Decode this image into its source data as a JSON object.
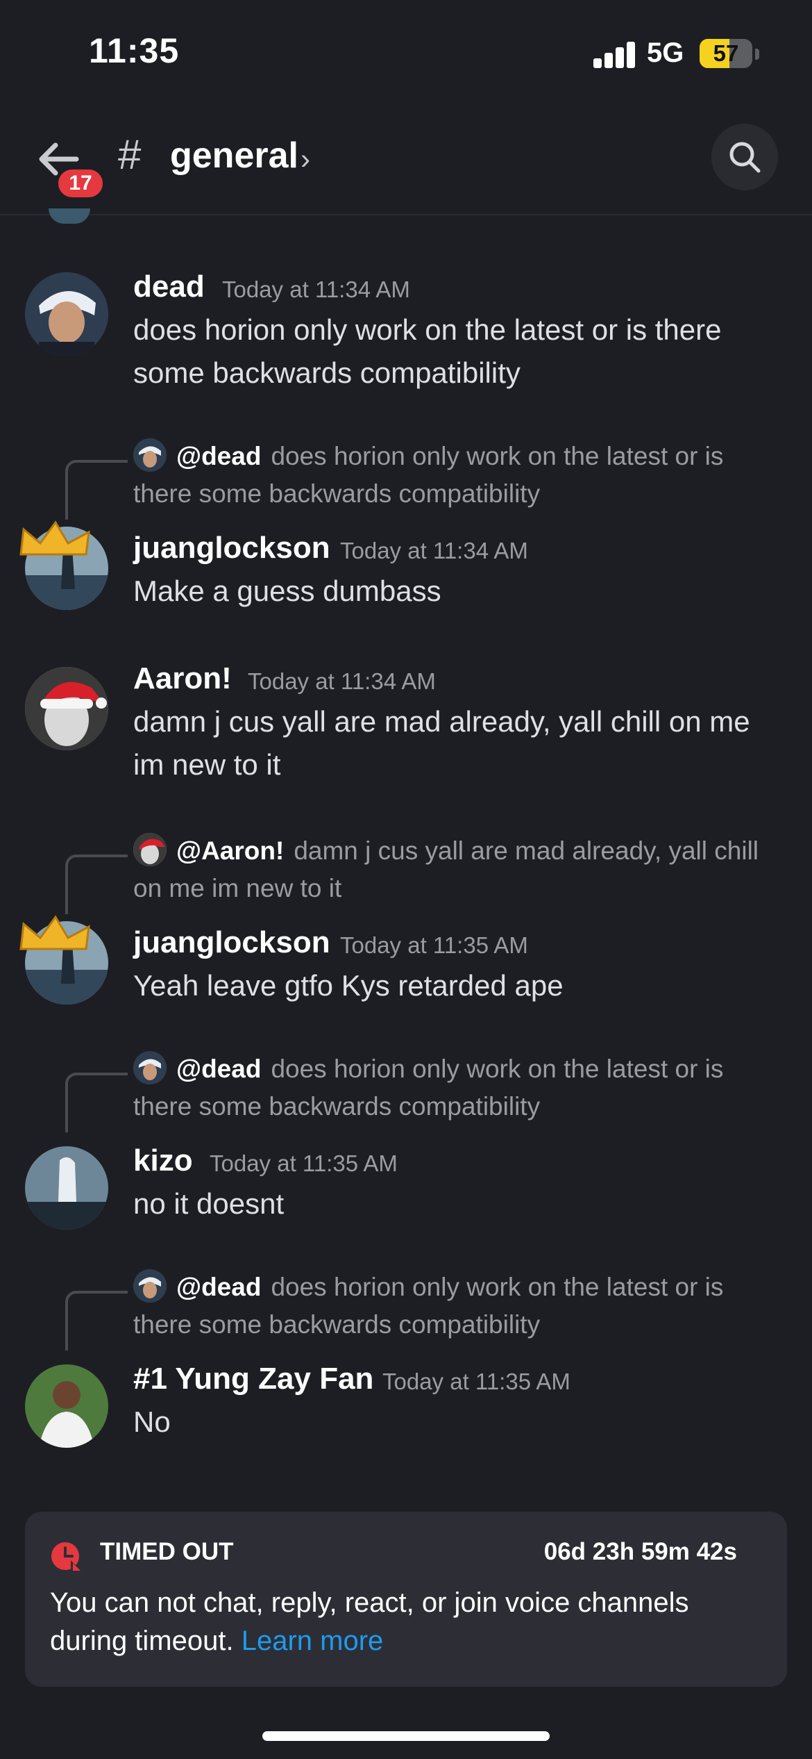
{
  "status": {
    "time": "11:35",
    "network": "5G",
    "battery": "57",
    "battery_level": 0.57
  },
  "header": {
    "hash": "#",
    "channel": "general",
    "chevron": "›",
    "badge": "17"
  },
  "messages": [
    {
      "username": "dead",
      "timestamp": "Today at 11:34 AM",
      "text": "does horion only work on the latest or is there some backwards compatibility"
    },
    {
      "reply_to": "@dead",
      "reply_text": "does horion only work on the latest or is there some backwards compatibility",
      "username": "juanglockson",
      "timestamp": "Today at 11:34 AM",
      "text": "Make a guess dumbass"
    },
    {
      "username": "Aaron!",
      "timestamp": "Today at 11:34 AM",
      "text": "damn j cus yall are mad already, yall chill on me im new to it"
    },
    {
      "reply_to": "@Aaron!",
      "reply_text": "damn j cus yall are mad already, yall chill on me im new to it",
      "username": "juanglockson",
      "timestamp": "Today at 11:35 AM",
      "text": "Yeah leave gtfo Kys retarded ape"
    },
    {
      "reply_to": "@dead",
      "reply_text": "does horion only work on the latest or is there some backwards compatibility",
      "username": "kizo",
      "timestamp": "Today at 11:35 AM",
      "text": "no it doesnt"
    },
    {
      "reply_to": "@dead",
      "reply_text": "does horion only work on the latest or is there some backwards compatibility",
      "username": "#1 Yung Zay Fan",
      "timestamp": "Today at 11:35 AM",
      "text": "No"
    }
  ],
  "timeout": {
    "title": "TIMED OUT",
    "countdown": "06d 23h 59m 42s",
    "text": "You can not chat, reply, react, or join voice channels during timeout.",
    "link": "Learn more"
  },
  "colors": {
    "background": "#1d1e23",
    "card": "#2d2e35",
    "link": "#1d9bf0",
    "badge": "#e5383f",
    "timeout_icon": "#e5383f"
  }
}
